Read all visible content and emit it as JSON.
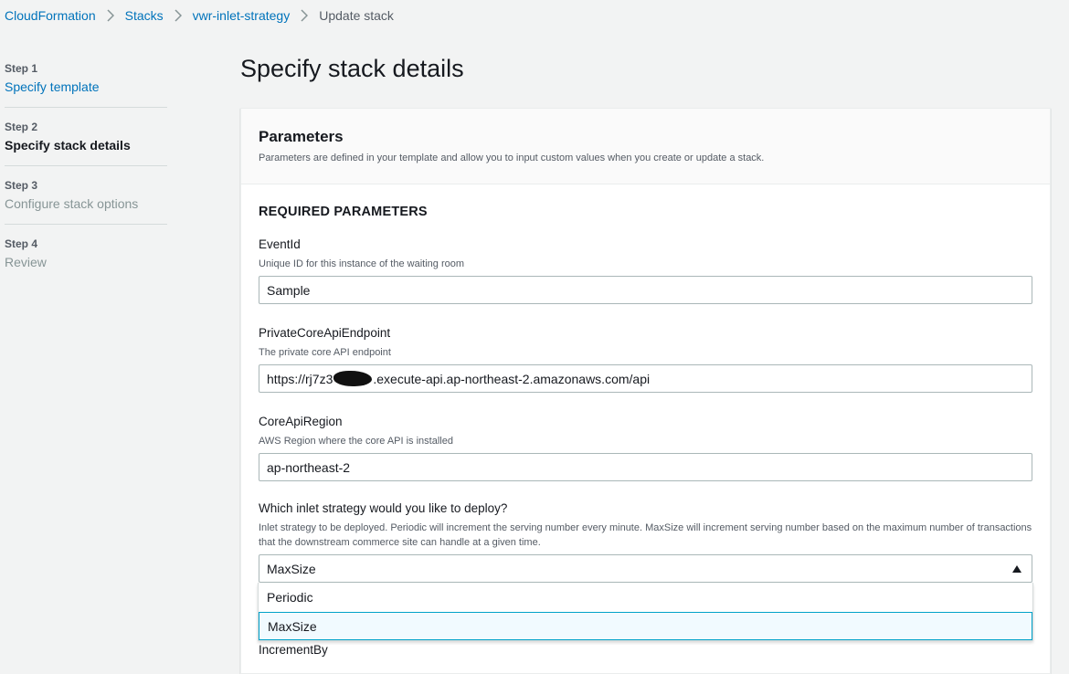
{
  "breadcrumb": {
    "items": [
      "CloudFormation",
      "Stacks",
      "vwr-inlet-strategy"
    ],
    "current": "Update stack"
  },
  "steps": [
    {
      "number": "Step 1",
      "title": "Specify template",
      "state": "link"
    },
    {
      "number": "Step 2",
      "title": "Specify stack details",
      "state": "active"
    },
    {
      "number": "Step 3",
      "title": "Configure stack options",
      "state": "disabled"
    },
    {
      "number": "Step 4",
      "title": "Review",
      "state": "disabled"
    }
  ],
  "page_title": "Specify stack details",
  "panel": {
    "title": "Parameters",
    "description": "Parameters are defined in your template and allow you to input custom values when you create or update a stack.",
    "section_title": "REQUIRED PARAMETERS"
  },
  "fields": {
    "event_id": {
      "label": "EventId",
      "description": "Unique ID for this instance of the waiting room",
      "value": "Sample"
    },
    "private_core_api": {
      "label": "PrivateCoreApiEndpoint",
      "description": "The private core API endpoint",
      "value_prefix": "https://rj7z3",
      "value_suffix": ".execute-api.ap-northeast-2.amazonaws.com/api"
    },
    "core_api_region": {
      "label": "CoreApiRegion",
      "description": "AWS Region where the core API is installed",
      "value": "ap-northeast-2"
    },
    "inlet_strategy": {
      "label": "Which inlet strategy would you like to deploy?",
      "description": "Inlet strategy to be deployed. Periodic will increment the serving number every minute. MaxSize will increment serving number based on the maximum number of transactions that the downstream commerce site can handle at a given time.",
      "selected": "MaxSize",
      "options": [
        "Periodic",
        "MaxSize"
      ]
    },
    "increment_by": {
      "label": "IncrementBy"
    }
  },
  "colors": {
    "link": "#0073bb",
    "annotation": "#f7a12c",
    "selected_border": "#00a1c9"
  }
}
